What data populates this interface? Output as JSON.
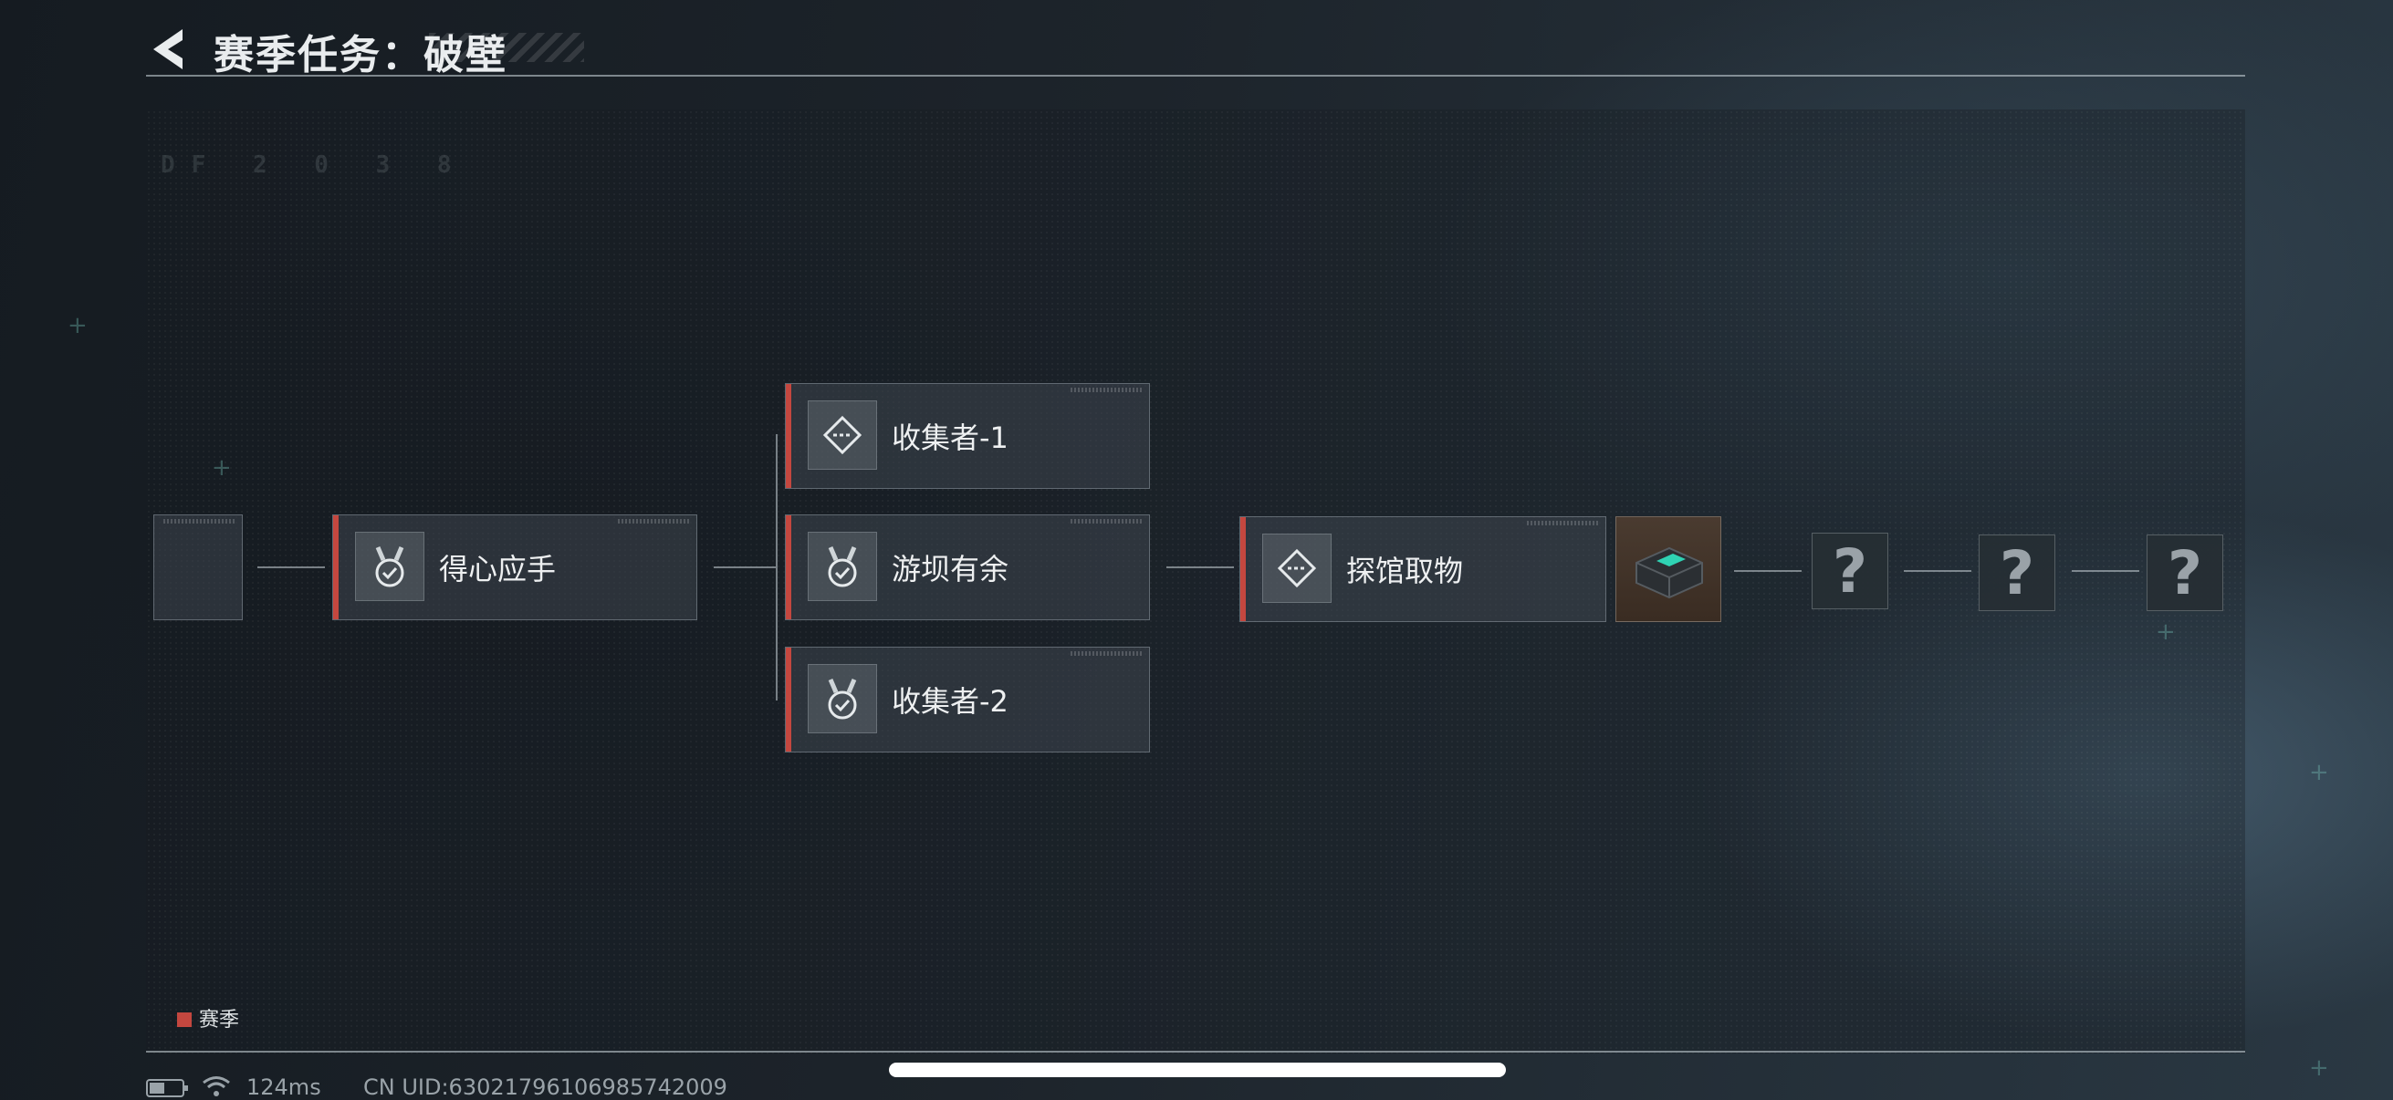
{
  "header": {
    "title": "赛季任务：破壁"
  },
  "background_text": {
    "line1": "DF 2 0 3 8"
  },
  "nodes": {
    "n1": {
      "label": "得心应手",
      "icon": "medal-check-icon"
    },
    "n2": {
      "label": "收集者-1",
      "icon": "diamond-dash-icon"
    },
    "n3": {
      "label": "游坝有余",
      "icon": "medal-check-icon"
    },
    "n4": {
      "label": "收集者-2",
      "icon": "medal-check-icon"
    },
    "n5": {
      "label": "探馆取物",
      "icon": "diamond-dash-icon"
    }
  },
  "reward": {
    "icon": "device-case-icon"
  },
  "locked": [
    "?",
    "?",
    "?"
  ],
  "legend": {
    "label": "赛季",
    "color": "#c4473f"
  },
  "status": {
    "ping": "124ms",
    "uid": "CN UID:630217961069857420​09"
  },
  "colors": {
    "accent": "#c4473f",
    "background": "#1b2128"
  }
}
